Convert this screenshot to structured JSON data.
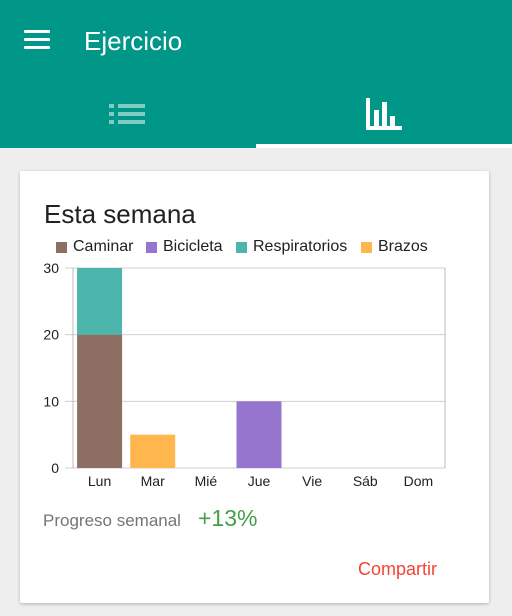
{
  "appbar": {
    "title": "Ejercicio",
    "color": "#009688"
  },
  "tabs": [
    {
      "icon": "list-icon",
      "selected": false
    },
    {
      "icon": "bar-chart-icon",
      "selected": true
    }
  ],
  "card": {
    "title": "Esta semana",
    "progress_label": "Progreso semanal",
    "progress_value": "+13%",
    "share_label": "Compartir"
  },
  "chart_data": {
    "type": "bar",
    "stacked": true,
    "categories": [
      "Lun",
      "Mar",
      "Mié",
      "Jue",
      "Vie",
      "Sáb",
      "Dom"
    ],
    "series": [
      {
        "name": "Caminar",
        "color": "#8d6e63",
        "values": [
          20,
          0,
          0,
          0,
          0,
          0,
          0
        ]
      },
      {
        "name": "Bicicleta",
        "color": "#9575cd",
        "values": [
          0,
          0,
          0,
          10,
          0,
          0,
          0
        ]
      },
      {
        "name": "Respiratorios",
        "color": "#4db6ac",
        "values": [
          10,
          0,
          0,
          0,
          0,
          0,
          0
        ]
      },
      {
        "name": "Brazos",
        "color": "#ffb74d",
        "values": [
          0,
          5,
          0,
          0,
          0,
          0,
          0
        ]
      }
    ],
    "ylim": [
      0,
      30
    ],
    "yticks": [
      0,
      10,
      20,
      30
    ],
    "grid": true,
    "legend_position": "top-left"
  }
}
